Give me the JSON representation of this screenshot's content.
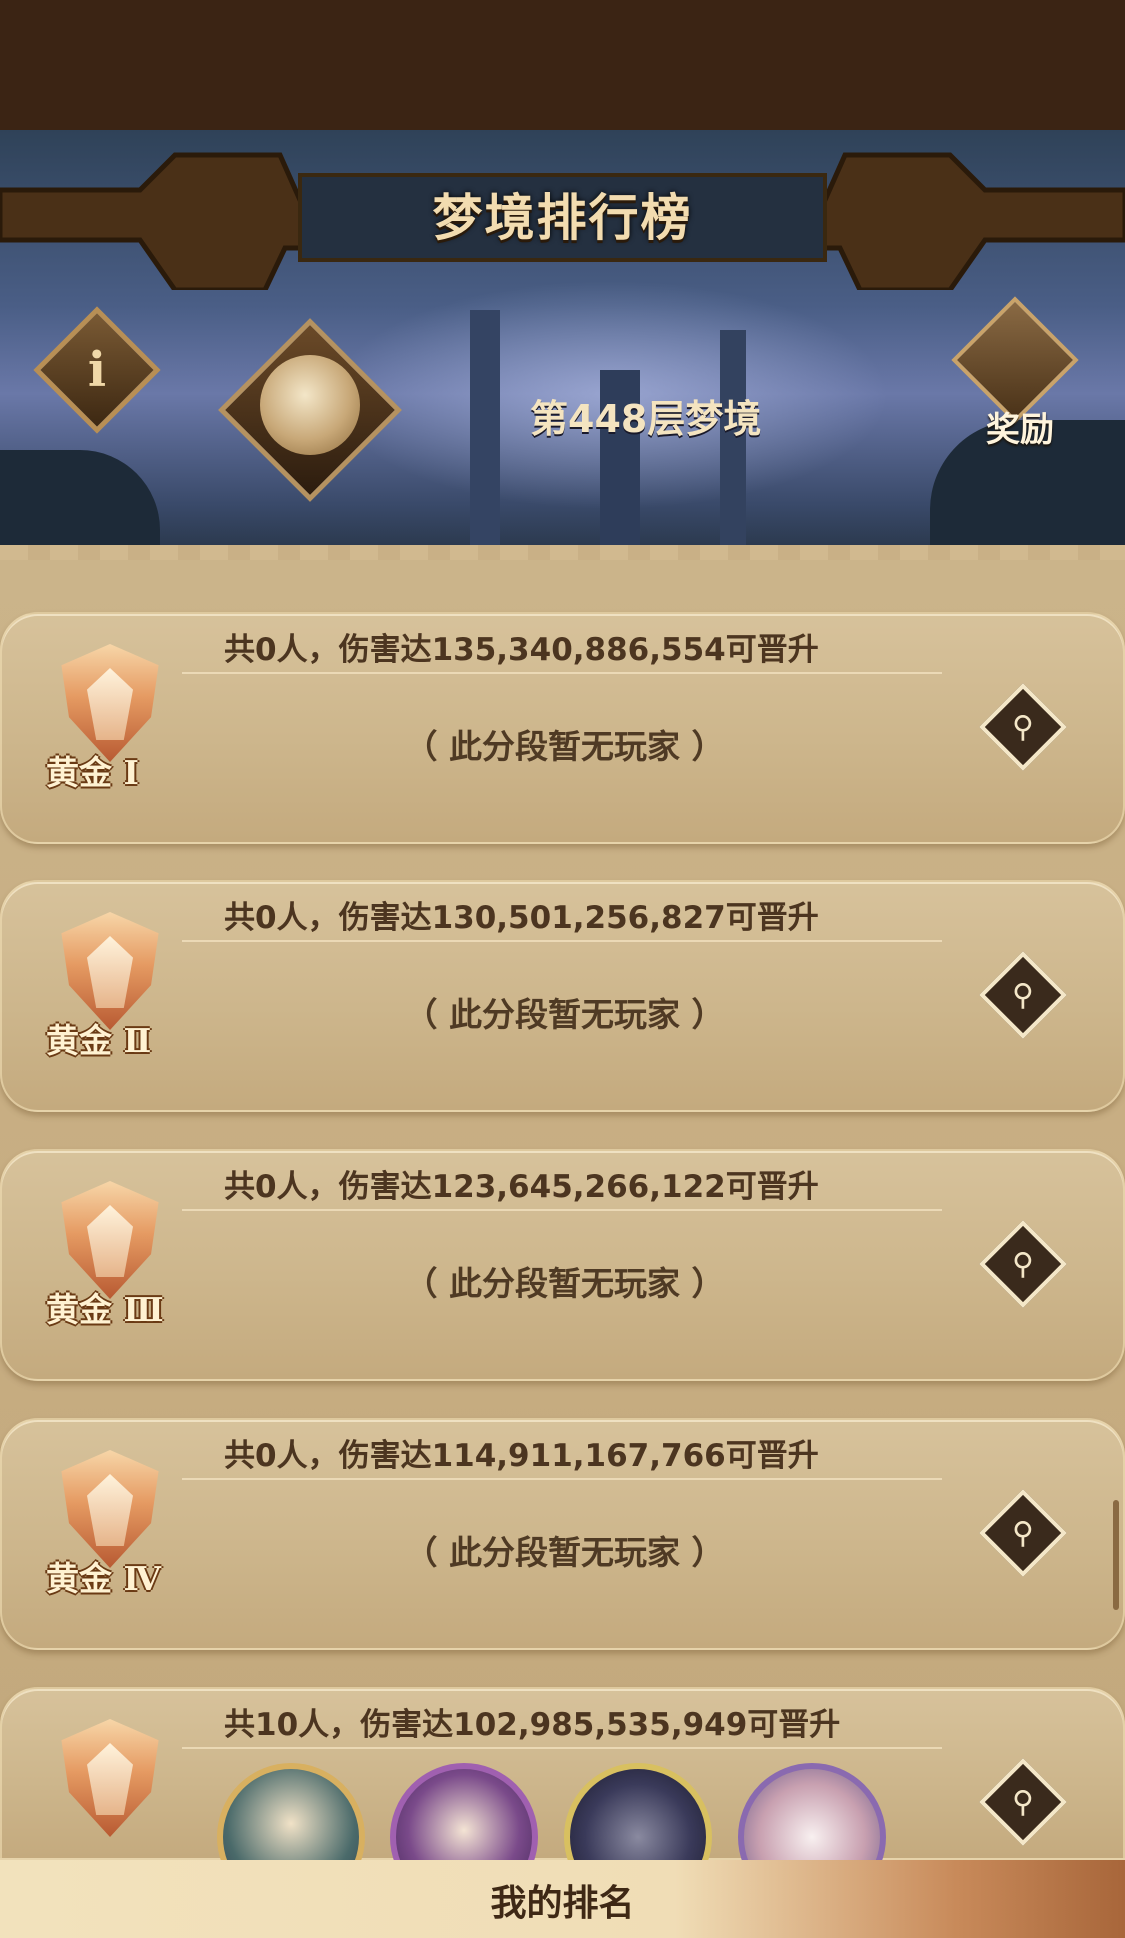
{
  "header": {
    "title": "梦境排行榜"
  },
  "banner": {
    "layer_text": "第448层梦境",
    "reward_label": "奖励",
    "info_icon": "info-icon",
    "reward_icon": "reward-chest-icon"
  },
  "tiers": [
    {
      "rank": "黄金 Ⅰ",
      "requirement": "共0人，伤害达135,340,886,554可晋升",
      "empty_text": "（ 此分段暂无玩家 ）"
    },
    {
      "rank": "黄金 Ⅱ",
      "requirement": "共0人，伤害达130,501,256,827可晋升",
      "empty_text": "（ 此分段暂无玩家 ）"
    },
    {
      "rank": "黄金 Ⅲ",
      "requirement": "共0人，伤害达123,645,266,122可晋升",
      "empty_text": "（ 此分段暂无玩家 ）"
    },
    {
      "rank": "黄金 Ⅳ",
      "requirement": "共0人，伤害达114,911,167,766可晋升",
      "empty_text": "（ 此分段暂无玩家 ）"
    },
    {
      "rank": "",
      "requirement": "共10人，伤害达102,985,535,949可晋升",
      "empty_text": ""
    }
  ],
  "footer": {
    "my_rank_label": "我的排名"
  },
  "colors": {
    "accent_gold": "#c9a36a",
    "panel": "#cdb68c",
    "text_dark": "#4c3520"
  }
}
